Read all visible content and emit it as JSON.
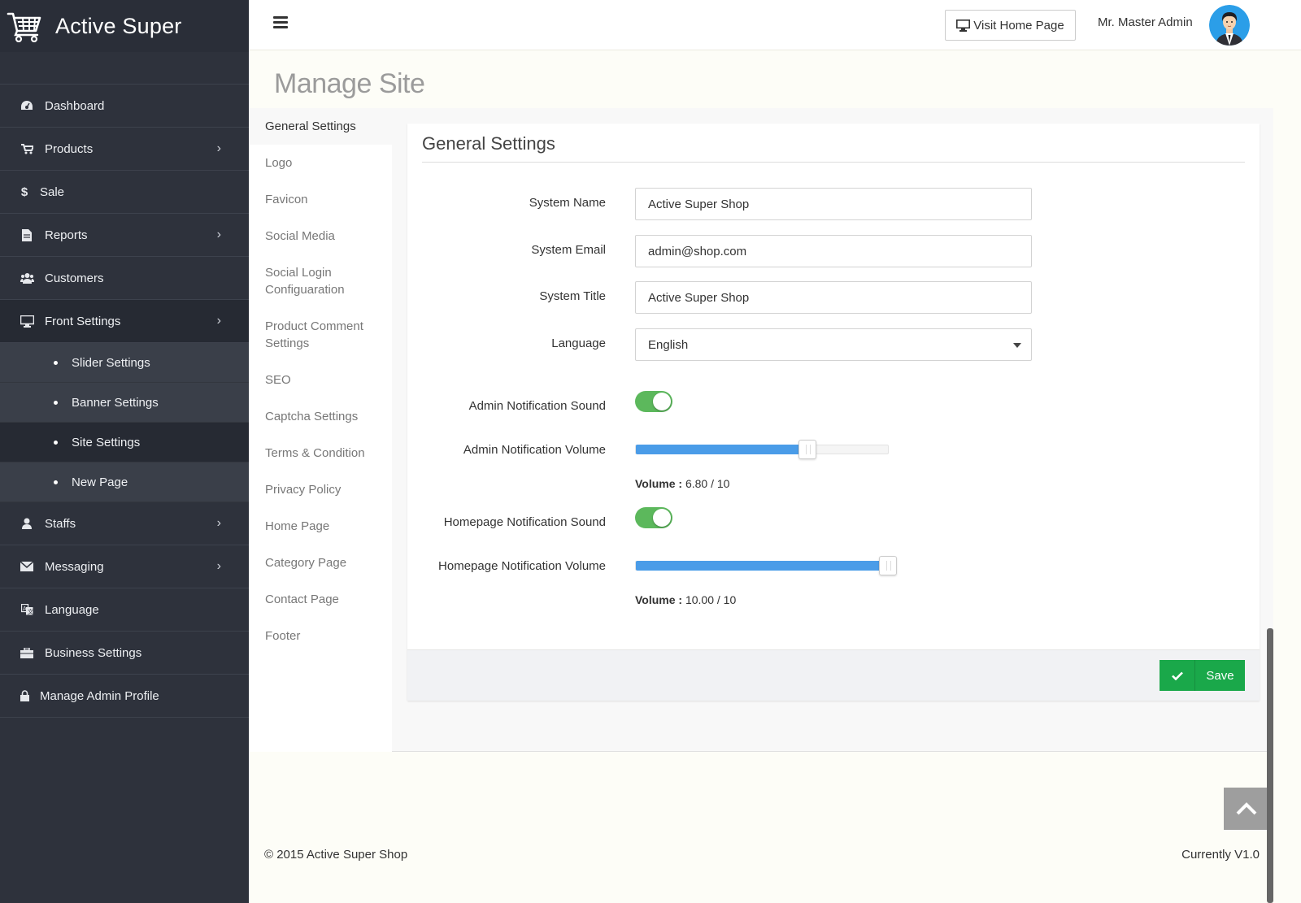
{
  "brand": {
    "name": "Active Super"
  },
  "sidebar": {
    "items": [
      {
        "label": "Dashboard",
        "icon": "dashboard-icon"
      },
      {
        "label": "Products",
        "icon": "cart-icon",
        "has_children": true
      },
      {
        "label": "Sale",
        "icon": "dollar-icon"
      },
      {
        "label": "Reports",
        "icon": "file-icon",
        "has_children": true
      },
      {
        "label": "Customers",
        "icon": "users-icon"
      },
      {
        "label": "Front Settings",
        "icon": "desktop-icon",
        "has_children": true,
        "expanded": true
      },
      {
        "label": "Staffs",
        "icon": "user-icon",
        "has_children": true
      },
      {
        "label": "Messaging",
        "icon": "envelope-icon",
        "has_children": true
      },
      {
        "label": "Language",
        "icon": "language-icon"
      },
      {
        "label": "Business Settings",
        "icon": "briefcase-icon"
      },
      {
        "label": "Manage Admin Profile",
        "icon": "lock-icon"
      }
    ],
    "front_settings_children": [
      {
        "label": "Slider Settings"
      },
      {
        "label": "Banner Settings"
      },
      {
        "label": "Site Settings",
        "active": true
      },
      {
        "label": "New Page"
      }
    ]
  },
  "header": {
    "visit_home_label": "Visit Home Page",
    "admin_name": "Mr. Master Admin"
  },
  "page": {
    "title": "Manage Site"
  },
  "settings_nav": [
    "General Settings",
    "Logo",
    "Favicon",
    "Social Media",
    "Social Login Configuaration",
    "Product Comment Settings",
    "SEO",
    "Captcha Settings",
    "Terms & Condition",
    "Privacy Policy",
    "Home Page",
    "Category Page",
    "Contact Page",
    "Footer"
  ],
  "panel": {
    "title": "General Settings",
    "fields": {
      "system_name": {
        "label": "System Name",
        "value": "Active Super Shop"
      },
      "system_email": {
        "label": "System Email",
        "value": "admin@shop.com"
      },
      "system_title": {
        "label": "System Title",
        "value": "Active Super Shop"
      },
      "language": {
        "label": "Language",
        "value": "English"
      },
      "admin_sound": {
        "label": "Admin Notification Sound",
        "on": true
      },
      "admin_volume": {
        "label": "Admin Notification Volume",
        "value": 6.8,
        "max": 10,
        "prefix": "Volume :",
        "text": "6.80 / 10"
      },
      "home_sound": {
        "label": "Homepage Notification Sound",
        "on": true
      },
      "home_volume": {
        "label": "Homepage Notification Volume",
        "value": 10.0,
        "max": 10,
        "prefix": "Volume :",
        "text": "10.00 / 10"
      }
    },
    "save_label": "Save"
  },
  "footer": {
    "copyright": "© 2015 Active Super Shop",
    "version": "Currently V1.0"
  },
  "colors": {
    "sidebar_bg": "#2e323c",
    "toggle_on": "#5cb85c",
    "slider_fill": "#4a9ce8",
    "save_button": "#1aa84a"
  }
}
